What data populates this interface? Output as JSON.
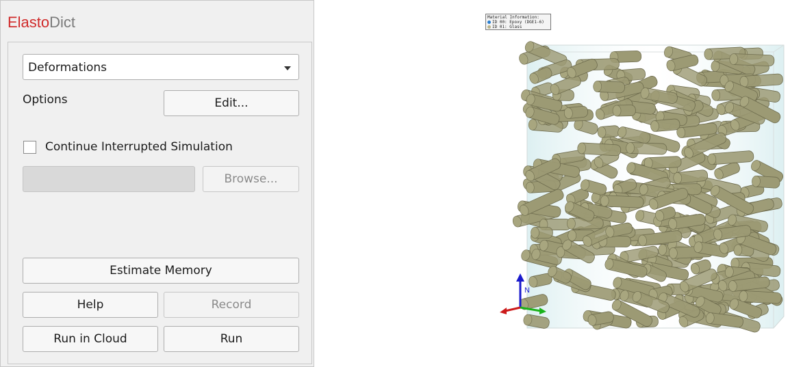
{
  "app": {
    "title_part1": "Elasto",
    "title_part2": "Dict"
  },
  "solver": {
    "selected": "Deformations"
  },
  "options": {
    "label": "Options",
    "edit_button": "Edit..."
  },
  "continue_sim": {
    "label": "Continue Interrupted Simulation",
    "checked": false
  },
  "path": {
    "value": "",
    "browse_button": "Browse..."
  },
  "actions": {
    "estimate_memory": "Estimate Memory",
    "help": "Help",
    "record": "Record",
    "run_in_cloud": "Run in Cloud",
    "run": "Run"
  },
  "viewport": {
    "legend_title": "Material Information:",
    "materials": [
      {
        "label": "ID 00: Epoxy (DGE1-6)",
        "color": "#2a7fd0"
      },
      {
        "label": "ID 01: Glass",
        "color": "#b9b38a"
      }
    ],
    "fiber_color": "#9c9a74",
    "axis_colors": {
      "n": "#1a1acc",
      "x": "#cc1a1a",
      "y": "#1ab31a"
    },
    "axis_label": "N"
  }
}
